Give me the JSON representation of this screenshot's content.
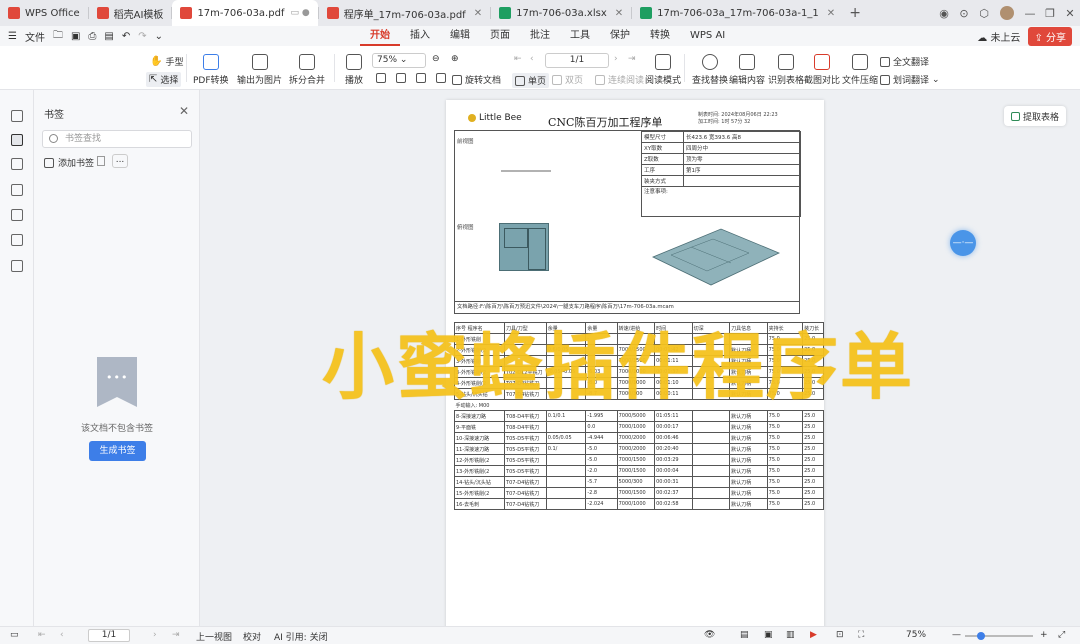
{
  "titlebar": {
    "tabs": [
      {
        "label": "WPS Office",
        "icon": "wps-logo-icon",
        "color": "#e0483b"
      },
      {
        "label": "稻壳AI模板",
        "icon": "docer-icon",
        "color": "#e0483b"
      },
      {
        "label": "17m-706-03a.pdf",
        "icon": "pdf-icon",
        "color": "#e0483b",
        "active": true
      },
      {
        "label": "程序单_17m-706-03a.pdf",
        "icon": "pdf-icon",
        "color": "#e0483b"
      },
      {
        "label": "17m-706-03a.xlsx",
        "icon": "excel-icon",
        "color": "#1e9e61"
      },
      {
        "label": "17m-706-03a_17m-706-03a-1_1",
        "icon": "excel-icon",
        "color": "#1e9e61"
      }
    ]
  },
  "menubar": {
    "file": "文件",
    "menus": [
      "开始",
      "插入",
      "编辑",
      "页面",
      "批注",
      "工具",
      "保护",
      "转换",
      "WPS AI"
    ],
    "cloud": "未上云",
    "share": "分享"
  },
  "ribbon": {
    "hand": "手型",
    "select": "选择",
    "pdf_convert": "PDF转换",
    "export_image": "输出为图片",
    "split_merge": "拆分合并",
    "play": "播放",
    "zoom": "75%",
    "rotate": "旋转文档",
    "page_nav": "1/1",
    "single": "单页",
    "double": "双页",
    "continuous": "连续阅读",
    "read_mode": "阅读模式",
    "find_replace": "查找替换",
    "edit_content": "编辑内容",
    "recognize_table": "识别表格",
    "screenshot_compare": "截图对比",
    "compress": "文件压缩",
    "full_translate": "全文翻译",
    "word_translate": "划词翻译"
  },
  "bookmark_panel": {
    "title": "书签",
    "search_placeholder": "书签查找",
    "add": "添加书签",
    "more": "...",
    "empty_text": "该文档不包含书签",
    "generate": "生成书签"
  },
  "document": {
    "logo": "Little Bee",
    "title": "CNC陈百万加工程序单",
    "meta_line1": "制表时间: 2024年08月06日 22:23",
    "meta_line2": "加工时间: 1时 57分 32",
    "label_front": "前视图",
    "label_top": "俯视图",
    "props": [
      [
        "模型尺寸",
        "长423.6 宽393.6 高8"
      ],
      [
        "XY取数",
        "四周分中"
      ],
      [
        "Z取数",
        "顶为零"
      ],
      [
        "工序",
        "第1序"
      ],
      [
        "装夹方式",
        ""
      ],
      [
        "注意事项:",
        ""
      ]
    ],
    "path": "文档路径:F:\\陈百万\\陈百万预迅文件\\2024\\一腿支车刀路程序\\陈百万\\17m-706-03a.mcam",
    "ops_header": [
      "序号 程序名",
      "刀具/刀型",
      "余量",
      "余量",
      "转速/进给",
      "时间",
      "切深",
      "刀具信息",
      "夹持长",
      "装刀长"
    ],
    "ops": [
      [
        "1-外形铣削",
        "",
        "",
        "-",
        "",
        "",
        "",
        "",
        "75.0",
        "25.0"
      ],
      [
        "2-外形铣削(2",
        "",
        "0.6/0.05",
        "-",
        "7000/1500",
        "00:01:42",
        "",
        "默认刀柄",
        "75.0",
        "25.0"
      ],
      [
        "3-外形铣削",
        "",
        "",
        "",
        "7000/1500",
        "00:01:11",
        "",
        "默认刀柄",
        "75.0",
        "25.0"
      ],
      [
        "3-外形铣削(2",
        "T02-D12平铣刀",
        "-0.05/-0.05",
        "-6.03",
        "7000/1000",
        "00:01:37",
        "",
        "默认刀柄",
        "75.0",
        "25.0"
      ],
      [
        "4-外形铣削(2",
        "T07-D4钻铣刀",
        "",
        "-8.0",
        "7000/1000",
        "00:01:10",
        "",
        "默认刀柄",
        "75.0",
        "25.0"
      ],
      [
        "5-钻头/沉头钻",
        "T07-D4钻铣刀",
        "",
        "-8.7",
        "7000/300",
        "00:00:11",
        "",
        "默认刀柄",
        "75.0",
        "25.0"
      ]
    ],
    "manual": "手动输入: M00",
    "ops2": [
      [
        "8-深接速刀路",
        "T08-D4平铣刀",
        "0.1/0.1",
        "-1.995",
        "7000/5000",
        "01:05:11",
        "",
        "默认刀柄",
        "75.0",
        "25.0"
      ],
      [
        "9-平面铣",
        "T08-D4平铣刀",
        "",
        "0.0",
        "7000/1000",
        "00:00:17",
        "",
        "默认刀柄",
        "75.0",
        "25.0"
      ],
      [
        "10-深接速刀路",
        "T05-D5平铣刀",
        "0.05/0.05",
        "-4.944",
        "7000/2000",
        "00:06:46",
        "",
        "默认刀柄",
        "75.0",
        "25.0"
      ],
      [
        "11-深接速刀路",
        "T05-D5平铣刀",
        "0.1/",
        "-5.0",
        "7000/2000",
        "00:20:40",
        "",
        "默认刀柄",
        "75.0",
        "25.0"
      ],
      [
        "12-外形铣削(2",
        "T05-D5平铣刀",
        "",
        "-5.0",
        "7000/1500",
        "00:03:29",
        "",
        "默认刀柄",
        "75.0",
        "25.0"
      ],
      [
        "13-外形铣削(2",
        "T05-D5平铣刀",
        "",
        "-2.0",
        "7000/1500",
        "00:00:04",
        "",
        "默认刀柄",
        "75.0",
        "25.0"
      ],
      [
        "14-钻头/沉头钻",
        "T07-D4钻铣刀",
        "",
        "-5.7",
        "5000/300",
        "00:00:31",
        "",
        "默认刀柄",
        "75.0",
        "25.0"
      ],
      [
        "15-外形铣削(2",
        "T07-D4钻铣刀",
        "",
        "-2.8",
        "7000/1500",
        "00:02:37",
        "",
        "默认刀柄",
        "75.0",
        "25.0"
      ],
      [
        "16-去毛刺",
        "T07-D4钻铣刀",
        "",
        "-2.024",
        "7000/1000",
        "00:02:58",
        "",
        "默认刀柄",
        "75.0",
        "25.0"
      ]
    ]
  },
  "overlay_text": "小蜜蜂插件程序单",
  "extract_table": "提取表格",
  "statusbar": {
    "page": "1/1",
    "prev_view": "上一视图",
    "proofread": "校对",
    "ai_quote": "AI 引用: 关闭",
    "zoom": "75%"
  }
}
